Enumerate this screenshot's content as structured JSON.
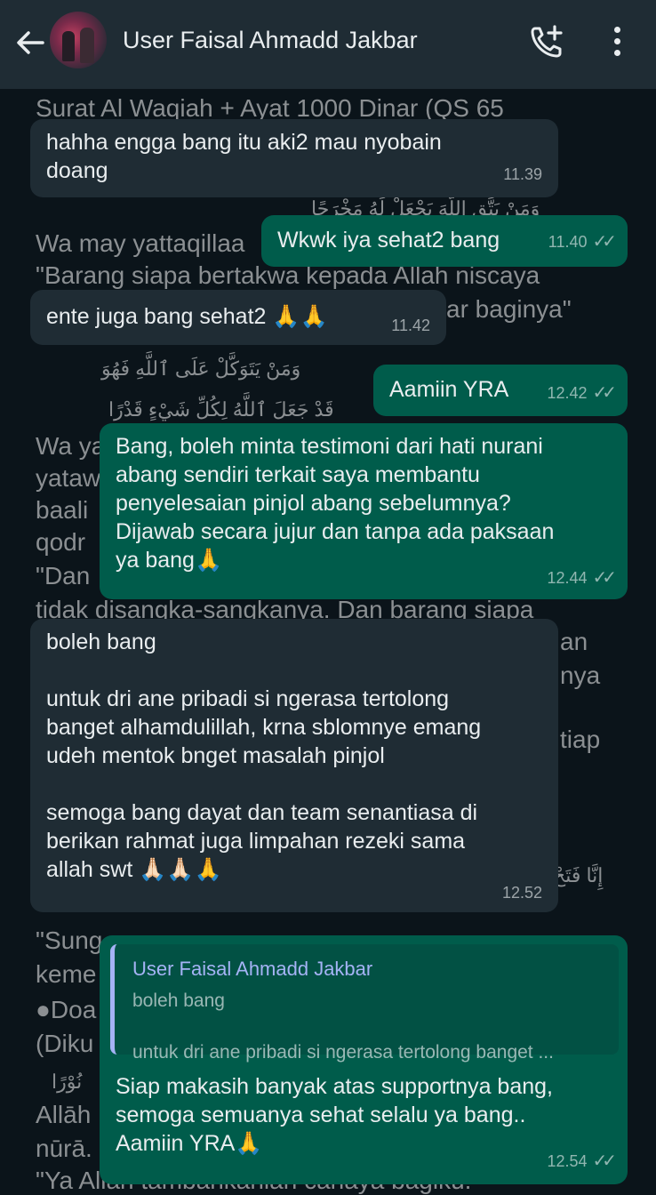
{
  "header": {
    "contact_name": "User Faisal Ahmadd Jakbar",
    "back_icon": "arrow-left-icon",
    "call_icon": "add-call-icon",
    "menu_icon": "more-vertical-icon"
  },
  "background_text": {
    "line1": "Surat Al Waqiah + Ayat 1000 Dinar (QS 65",
    "arabic1": "وَمَنْ يَتَّقِ اللَّهَ يَجْعَلْ لَهُ مَخْرَجًا",
    "line2": "Wa may yattaqillaa",
    "line3": "\"Barang siapa bertakwa kepada Allah niscaya",
    "line4": "ar baginya\"",
    "arabic2": "وَمَنْ يَتَوَكَّلْ عَلَى ٱللَّهِ فَهُوَ",
    "arabic3": "قَدْ جَعَلَ ٱللَّهُ لِكُلِّ شَيْءٍ قَدْرًا",
    "line5": "Wa ya",
    "line6": "yataw",
    "line7": "baali",
    "line8": "qodr",
    "line9": "\"Dan",
    "line10": "tidak disangka-sangkanya. Dan barang siapa",
    "line11": "an",
    "line12": "nya",
    "line13": "tiap",
    "arabic4": "إِنَّا فَتَحْ",
    "line14": "\"Sung",
    "line15": "keme",
    "line16": "●Doa",
    "line17": "(Diku",
    "arabic5": "نُوْرًا",
    "line18": "Allāh",
    "line19": "nūrā.",
    "line20": "\"Ya Allah tambahkanlah cahaya bagiku."
  },
  "messages": [
    {
      "type": "in",
      "text": "hahha engga bang itu aki2 mau nyobain\ndoang",
      "time": "11.39"
    },
    {
      "type": "out",
      "text": "Wkwk iya sehat2 bang",
      "time": "11.40"
    },
    {
      "type": "in",
      "text": "ente juga bang sehat2 🙏🙏",
      "time": "11.42"
    },
    {
      "type": "out",
      "text": "Aamiin YRA",
      "time": "12.42"
    },
    {
      "type": "out",
      "text": "Bang, boleh minta testimoni dari hati nurani\nabang sendiri terkait saya membantu\npenyelesaian pinjol abang sebelumnya?\nDijawab secara jujur dan tanpa ada paksaan\nya bang🙏",
      "time": "12.44"
    },
    {
      "type": "in",
      "text": "boleh bang\n\nuntuk dri ane pribadi si ngerasa tertolong\nbanget alhamdulillah, krna sblomnye emang\nudeh mentok bnget masalah pinjol\n\nsemoga bang dayat dan team senantiasa di\nberikan rahmat juga limpahan rezeki sama\nallah swt 🙏🏻🙏🏻🙏",
      "time": "12.52"
    },
    {
      "type": "out",
      "text": "Siap makasih banyak atas supportnya bang,\nsemoga semuanya sehat selalu ya bang..\nAamiin YRA🙏",
      "time": "12.54",
      "quote": {
        "name": "User Faisal Ahmadd Jakbar",
        "line1": "boleh bang",
        "line2": "untuk dri ane pribadi si ngerasa tertolong banget ..."
      }
    }
  ],
  "colors": {
    "incoming": "#1f2c34",
    "outgoing": "#005c4b",
    "background": "#0b141a",
    "quote_accent": "#a5b3f5"
  }
}
